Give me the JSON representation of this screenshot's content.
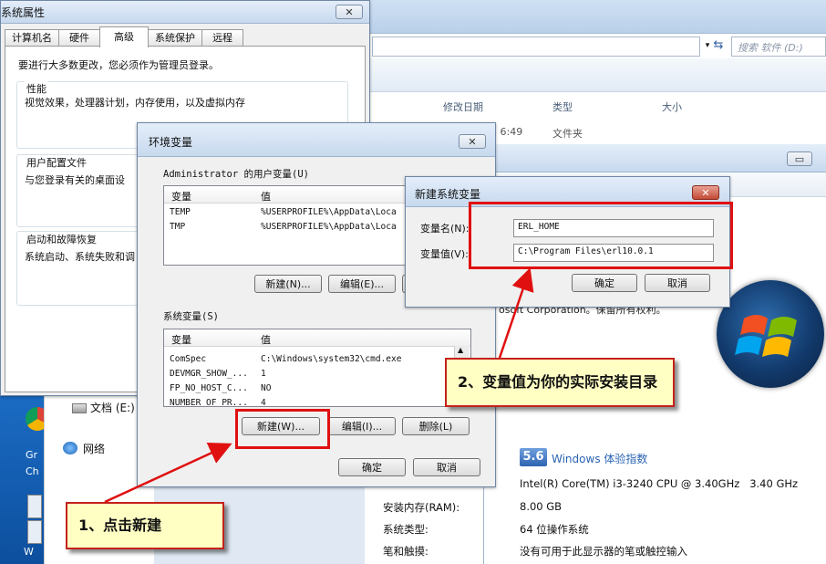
{
  "explorer": {
    "search_placeholder": "搜索 软件 (D:)",
    "columns": [
      "修改日期",
      "类型",
      "大小"
    ],
    "row": {
      "date": "3 6:49",
      "type": "文件夹"
    }
  },
  "nav": {
    "documents": "文档 (E:)",
    "network": "网络"
  },
  "sysinfo": {
    "copyright_fragment": "osoft Corporation。保留所有权利。",
    "wei_score": "5.6",
    "wei_label": "Windows 体验指数",
    "processor": "Intel(R) Core(TM) i3-3240 CPU @ 3.40GHz   3.40 GHz",
    "rows": [
      {
        "label": "安装内存(RAM):",
        "value": "8.00 GB"
      },
      {
        "label": "系统类型:",
        "value": "64 位操作系统"
      },
      {
        "label": "笔和触摸:",
        "value": "没有可用于此显示器的笔或触控输入"
      }
    ]
  },
  "system_properties": {
    "title": "系统属性",
    "tabs": [
      "计算机名",
      "硬件",
      "高级",
      "系统保护",
      "远程"
    ],
    "active_tab": "高级",
    "admin_note": "要进行大多数更改，您必须作为管理员登录。",
    "performance": {
      "title": "性能",
      "desc": "视觉效果，处理器计划，内存使用，以及虚拟内存"
    },
    "user_profiles": {
      "title": "用户配置文件",
      "desc": "与您登录有关的桌面设"
    },
    "startup": {
      "title": "启动和故障恢复",
      "desc": "系统启动、系统失败和调"
    }
  },
  "env_vars": {
    "title": "环境变量",
    "user_group": "Administrator 的用户变量(U)",
    "col_var": "变量",
    "col_val": "值",
    "user_vars": [
      {
        "name": "TEMP",
        "value": "%USERPROFILE%\\AppData\\Loca"
      },
      {
        "name": "TMP",
        "value": "%USERPROFILE%\\AppData\\Loca"
      }
    ],
    "user_buttons": {
      "new": "新建(N)...",
      "edit": "编辑(E)..."
    },
    "system_group": "系统变量(S)",
    "system_vars": [
      {
        "name": "ComSpec",
        "value": "C:\\Windows\\system32\\cmd.exe"
      },
      {
        "name": "DEVMGR_SHOW_...",
        "value": "1"
      },
      {
        "name": "FP_NO_HOST_C...",
        "value": "NO"
      },
      {
        "name": "NUMBER_OF_PR...",
        "value": "4"
      }
    ],
    "system_buttons": {
      "new": "新建(W)...",
      "edit": "编辑(I)...",
      "delete": "删除(L)"
    },
    "ok": "确定",
    "cancel": "取消"
  },
  "new_sys_var": {
    "title": "新建系统变量",
    "name_label": "变量名(N):",
    "value_label": "变量值(V):",
    "name_value": "ERL_HOME",
    "value_value": "C:\\Program Files\\erl10.0.1",
    "ok": "确定",
    "cancel": "取消"
  },
  "callouts": {
    "step1": "1、点击新建",
    "step2": "2、变量值为你的实际安装目录"
  },
  "desktop": {
    "gr": "Gr",
    "ch": "Ch",
    "w": "W"
  },
  "colors": {
    "callout_fill": "#ffffc4",
    "highlight_red": "#e01010",
    "wei_blue": "#3a6fb7"
  }
}
